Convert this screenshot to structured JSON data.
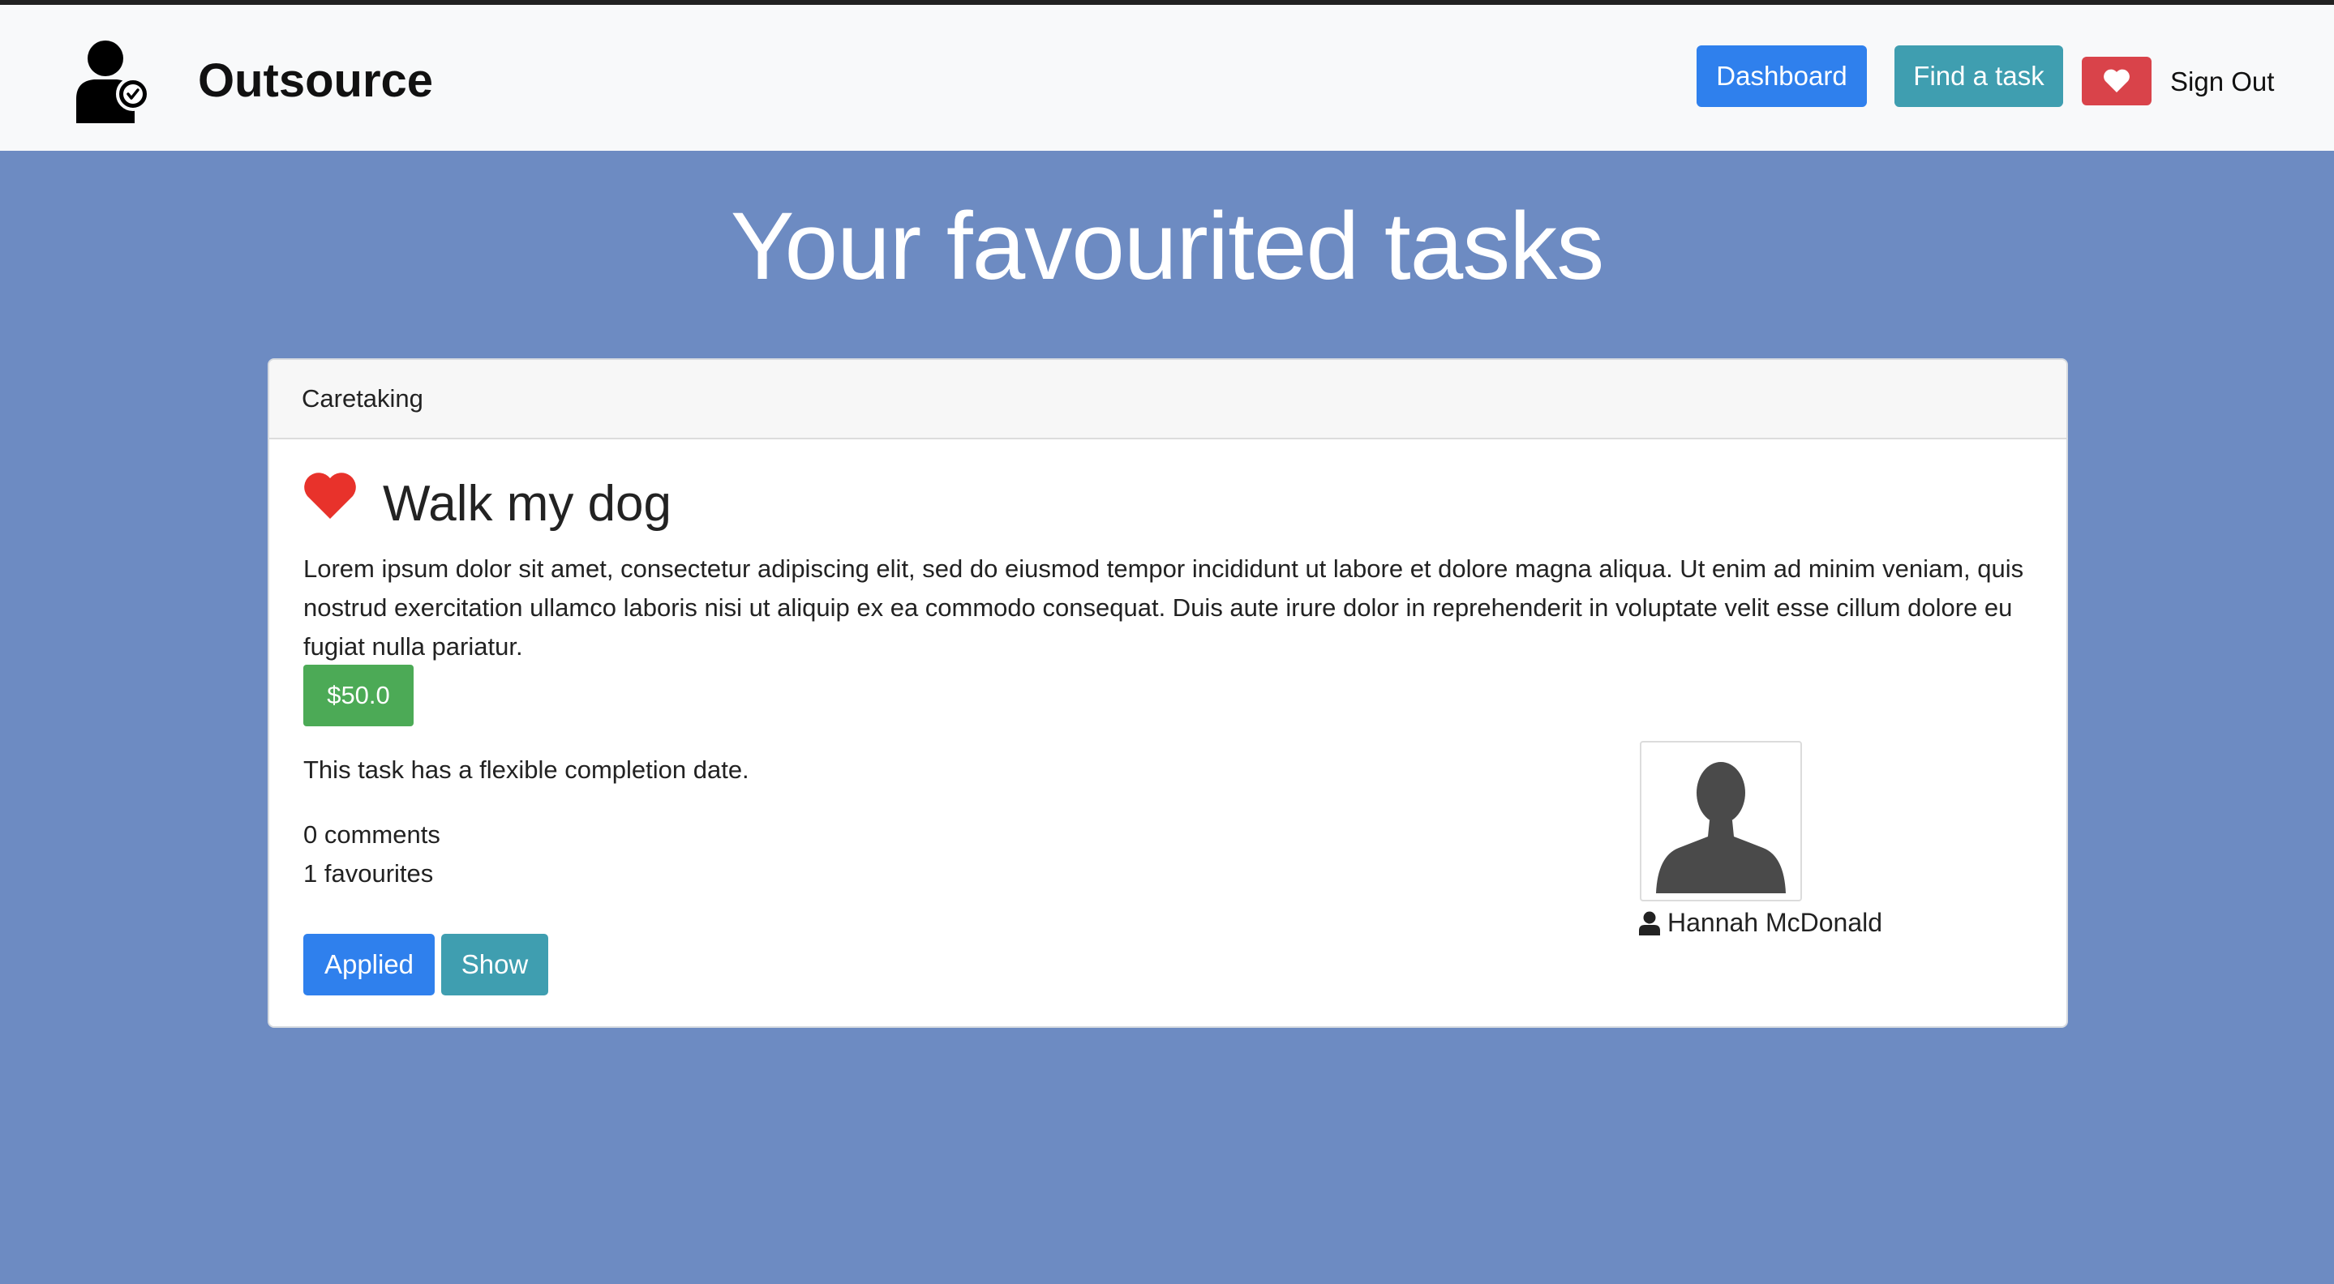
{
  "brand": {
    "name": "Outsource",
    "logo_icon": "user-check-icon"
  },
  "nav": {
    "dashboard_label": "Dashboard",
    "find_task_label": "Find a task",
    "favourites_icon": "heart-icon",
    "signout_label": "Sign Out"
  },
  "page": {
    "title": "Your favourited tasks"
  },
  "task": {
    "category": "Caretaking",
    "favourited_icon": "heart-icon",
    "title": "Walk my dog",
    "description": "Lorem ipsum dolor sit amet, consectetur adipiscing elit, sed do eiusmod tempor incididunt ut labore et dolore magna aliqua. Ut enim ad minim veniam, quis nostrud exercitation ullamco laboris nisi ut aliquip ex ea commodo consequat. Duis aute irure dolor in reprehenderit in voluptate velit esse cillum dolore eu fugiat nulla pariatur.",
    "price": "$50.0",
    "completion_note": "This task has a flexible completion date.",
    "comments": "0 comments",
    "favourites": "1 favourites",
    "applied_label": "Applied",
    "show_label": "Show",
    "poster_name": "Hannah McDonald",
    "poster_icon": "user-icon"
  },
  "colors": {
    "page_background": "#6d8bc2",
    "primary": "#2f80ed",
    "info": "#3f9eb0",
    "danger": "#d9434a",
    "success": "#4caa56",
    "heart": "#e8322b"
  }
}
